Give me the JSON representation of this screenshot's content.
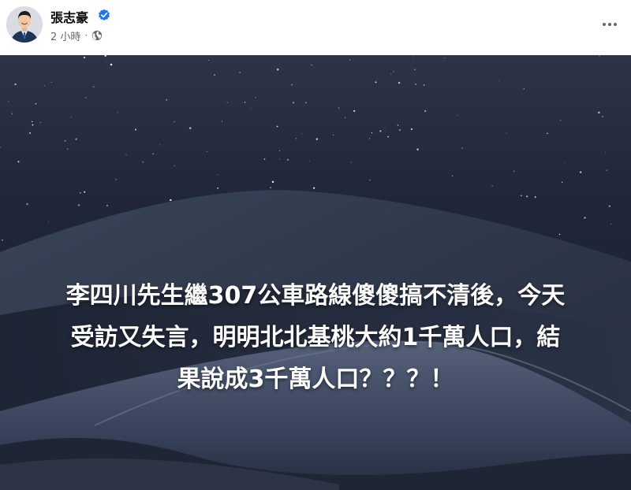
{
  "post": {
    "author_name": "張志豪",
    "timestamp": "2 小時",
    "separator": "·",
    "privacy_icon": "globe-icon",
    "verified_icon": "verified-badge-icon",
    "more_icon": "more-options-icon"
  },
  "image": {
    "lines": [
      "李四川先生繼307公車路線傻傻搞不清後，今天",
      "受訪又失言，明明北北基桃大約1千萬人口，結",
      "果說成3千萬人口？？？！"
    ]
  },
  "colors": {
    "name_text": "#050505",
    "meta_text": "#65676b",
    "verified_blue": "#1877f2",
    "sky_dark": "#1f2638",
    "dune_shadow": "#232b3b",
    "dune_light": "#3b4559"
  }
}
